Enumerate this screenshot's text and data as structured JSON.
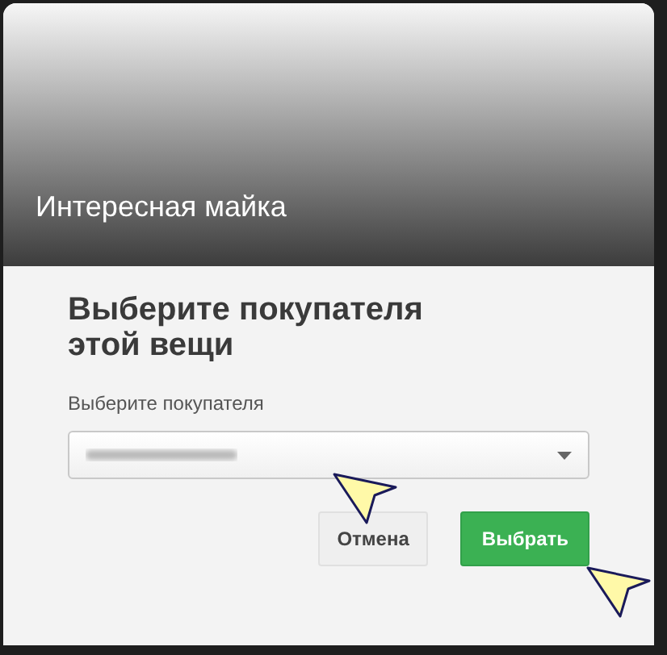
{
  "dialog": {
    "title": "Интересная майка",
    "heading": "Выберите покупателя этой вещи",
    "field": {
      "label": "Выберите покупателя"
    },
    "buttons": [
      {
        "label": "Отмена",
        "kind": "secondary"
      },
      {
        "label": "Выбрать",
        "kind": "primary"
      }
    ]
  }
}
